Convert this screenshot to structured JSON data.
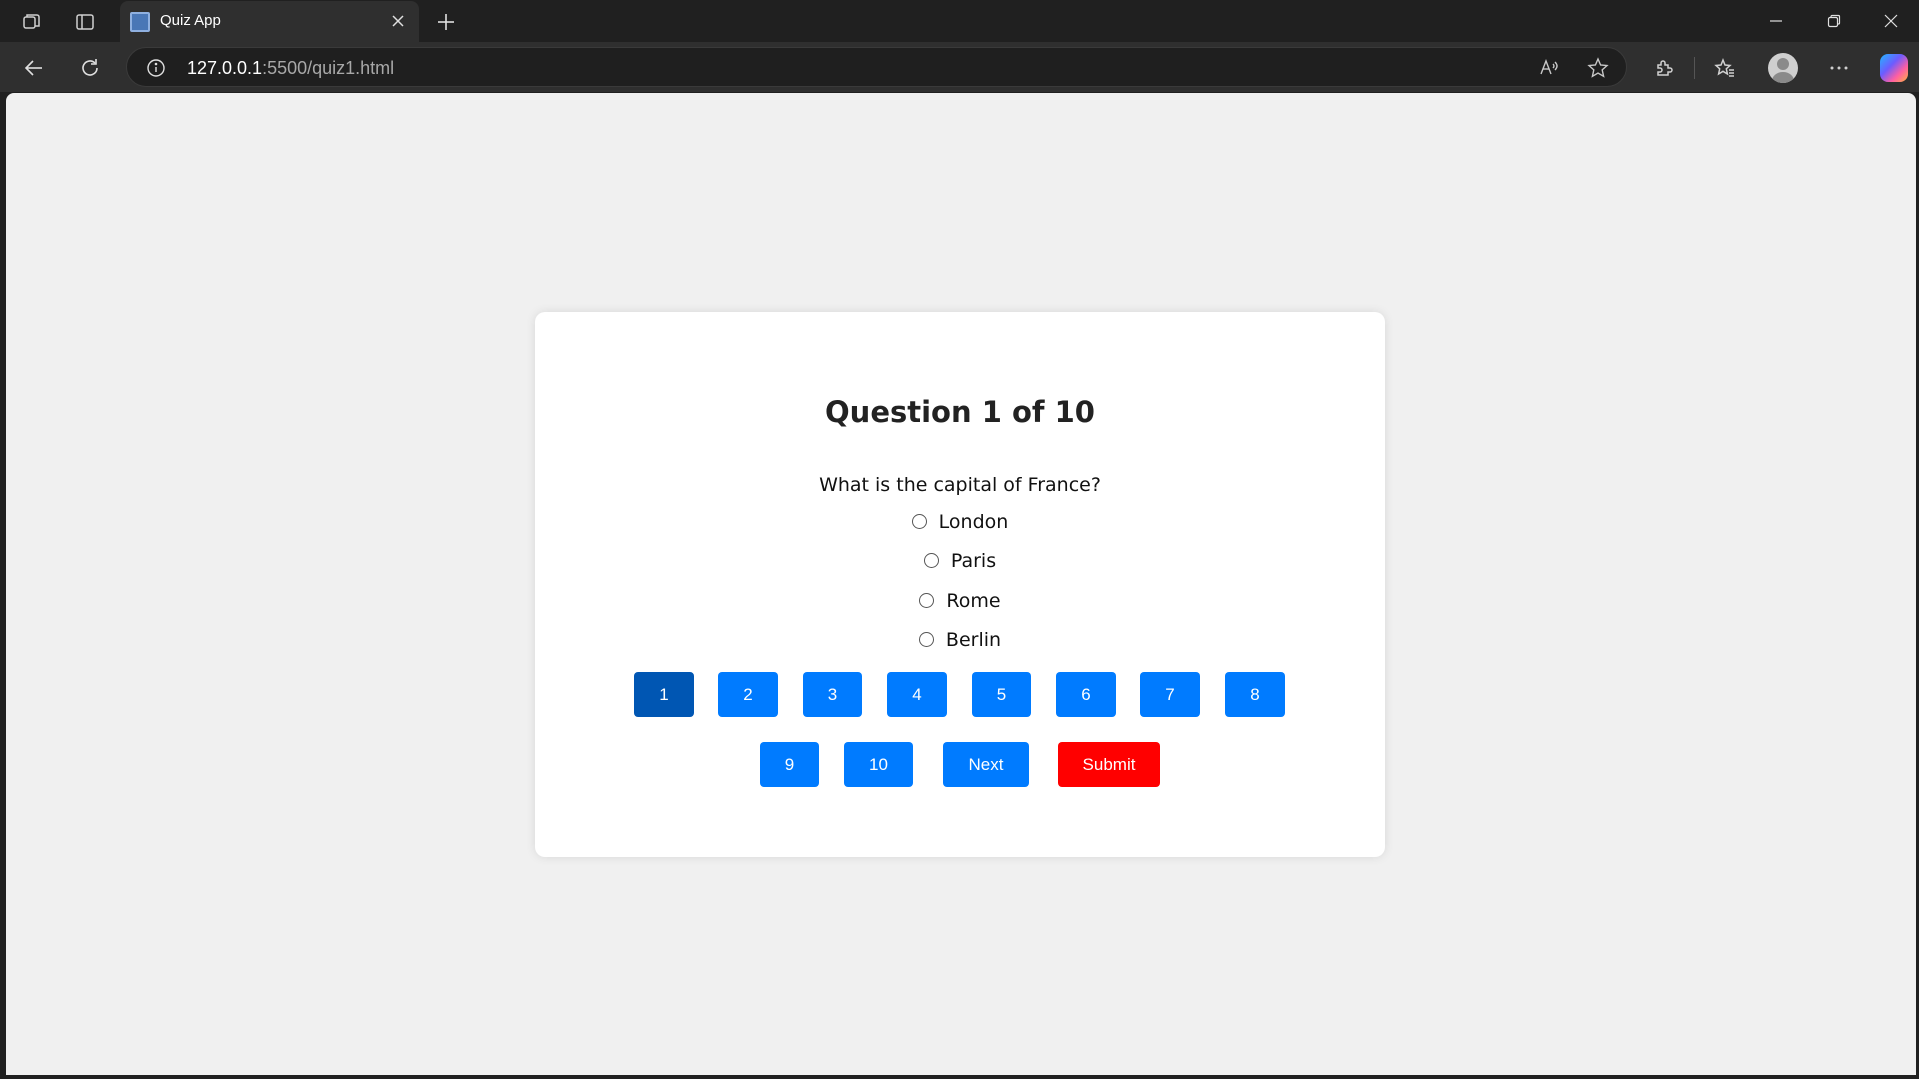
{
  "browser": {
    "tab_title": "Quiz App",
    "address_host": "127.0.0.1",
    "address_path": ":5500/quiz1.html"
  },
  "quiz": {
    "heading": "Question 1 of 10",
    "question": "What is the capital of France?",
    "options": [
      "London",
      "Paris",
      "Rome",
      "Berlin"
    ],
    "question_numbers": [
      "1",
      "2",
      "3",
      "4",
      "5",
      "6",
      "7",
      "8",
      "9",
      "10"
    ],
    "current_question": "1",
    "next_label": "Next",
    "submit_label": "Submit"
  },
  "colors": {
    "primary": "#007bff",
    "active": "#0056b3",
    "submit": "#ff0000",
    "page_bg": "#f0f0f0"
  }
}
